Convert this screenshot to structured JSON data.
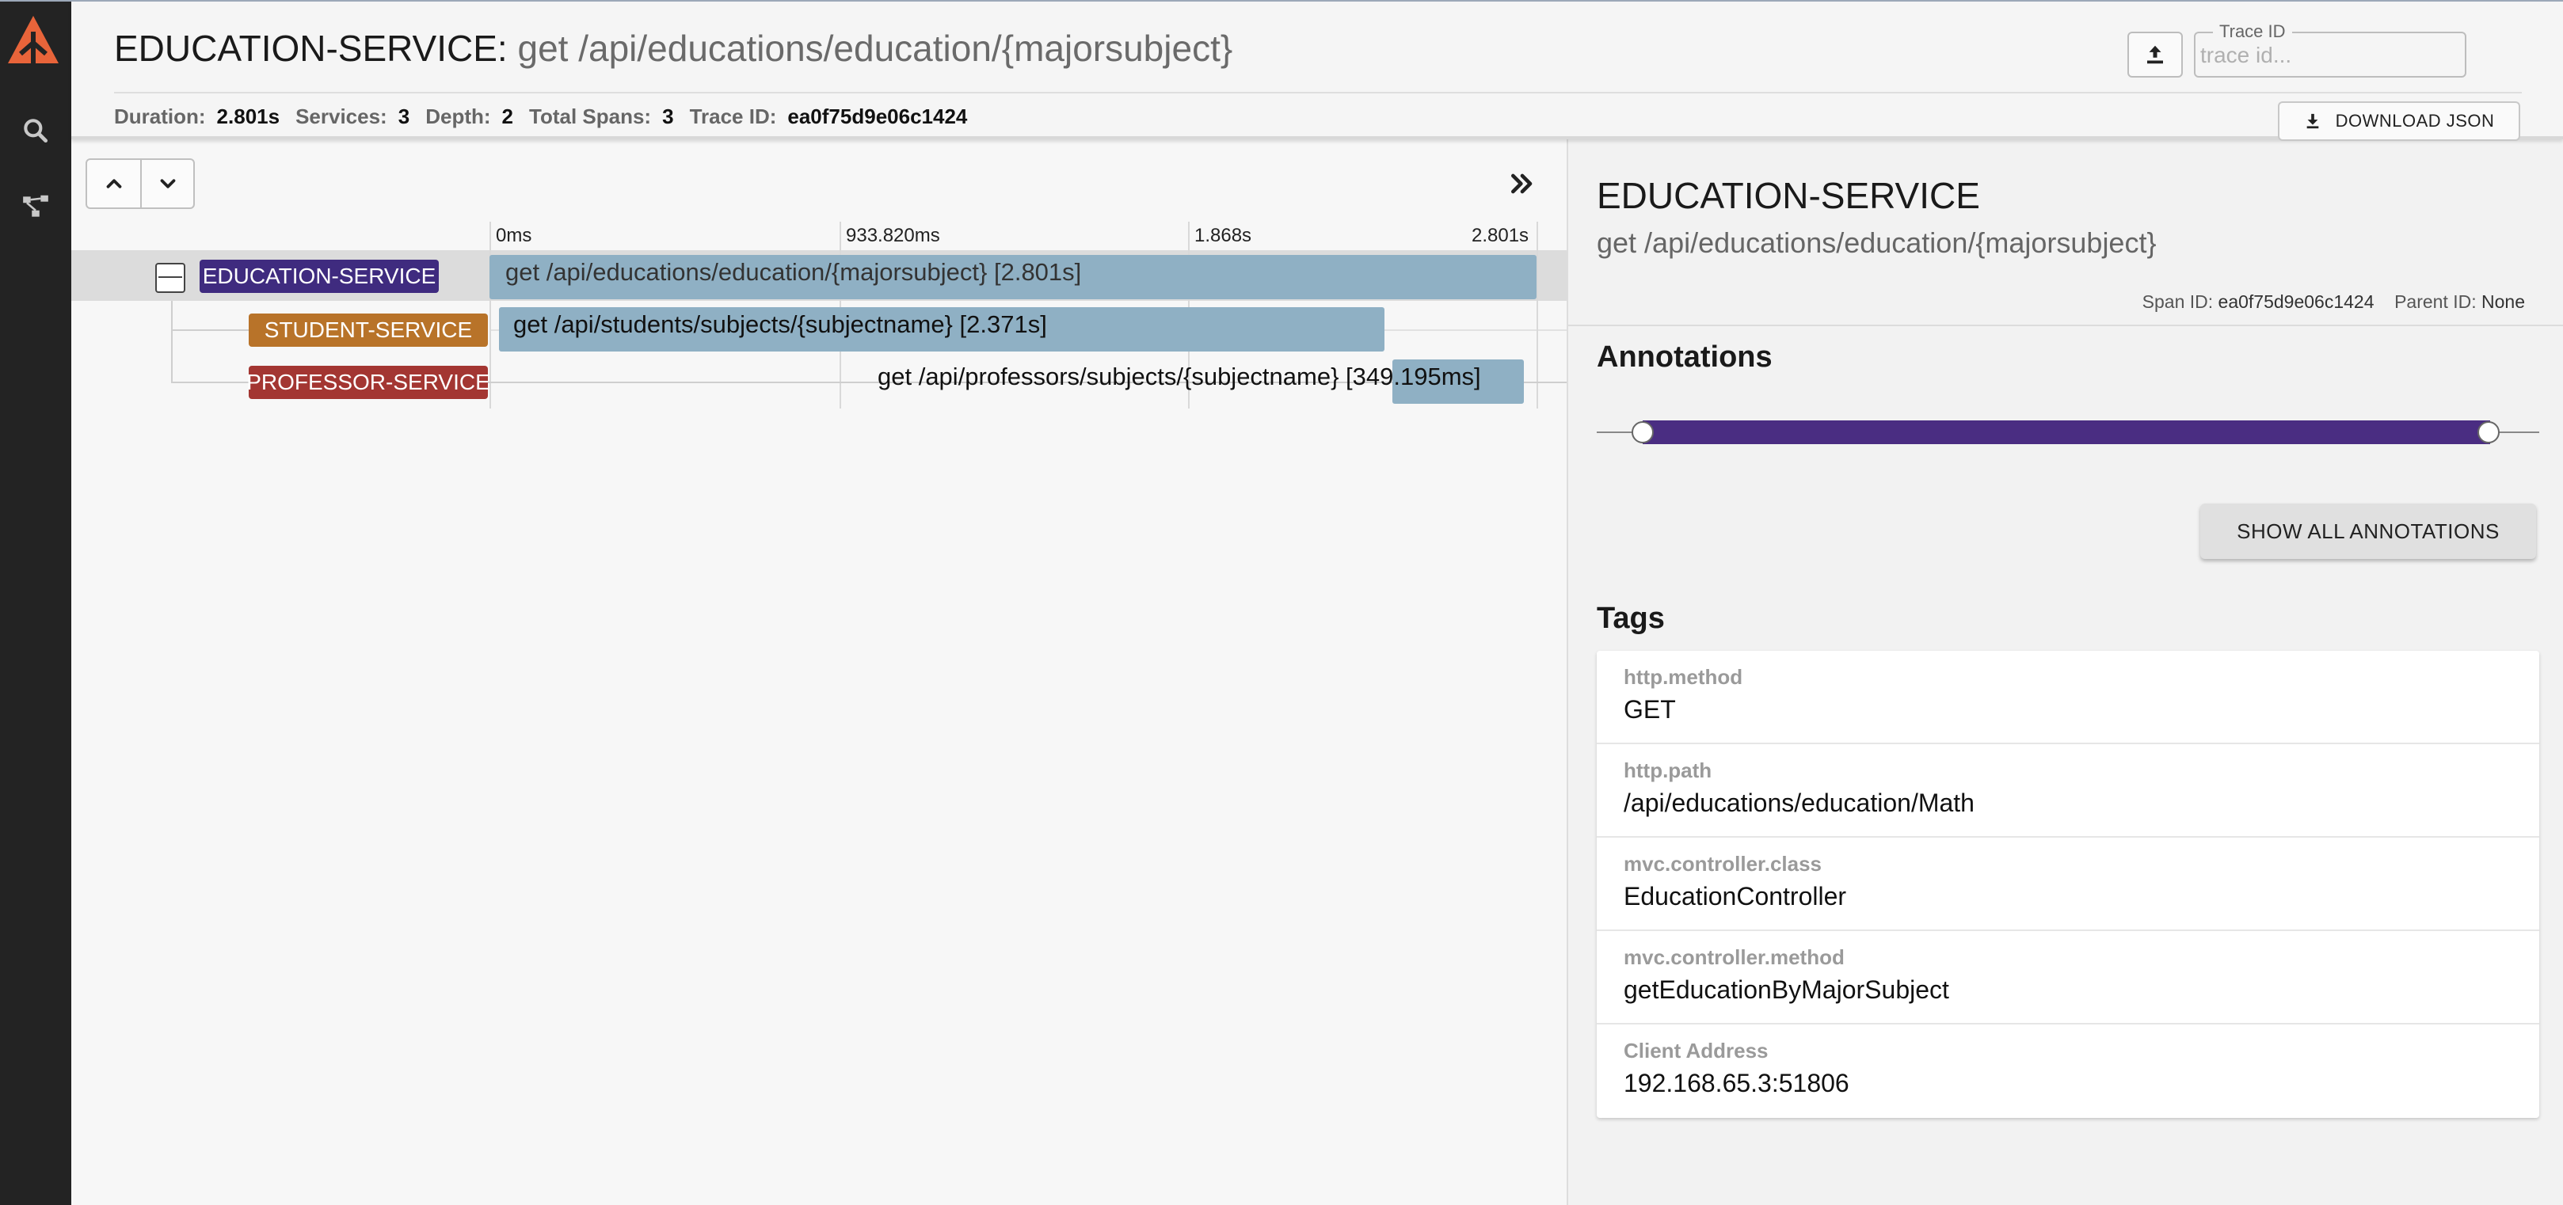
{
  "colors": {
    "sidebar_bg": "#232323",
    "logo_orange": "#e8643a",
    "education_service": "#3f2b7f",
    "student_service": "#b87329",
    "professor_service": "#a33632",
    "span_bar": "#8fb0c4",
    "annotation_bar": "#4a2d82"
  },
  "sidebar": {
    "icons": [
      "logo-icon",
      "search-icon",
      "dependency-graph-icon"
    ]
  },
  "header": {
    "service_name": "EDUCATION-SERVICE",
    "separator": ":",
    "operation": " get /api/educations/education/{majorsubject}",
    "stats": {
      "duration_label": "Duration:",
      "duration_value": "2.801s",
      "services_label": "Services:",
      "services_value": "3",
      "depth_label": "Depth:",
      "depth_value": "2",
      "total_spans_label": "Total Spans:",
      "total_spans_value": "3",
      "trace_id_label": "Trace ID:",
      "trace_id_value": "ea0f75d9e06c1424"
    },
    "trace_id_field": {
      "label": "Trace ID",
      "placeholder": "trace id..."
    },
    "download_label": "DOWNLOAD JSON"
  },
  "timeline": {
    "ticks": [
      "0ms",
      "933.820ms",
      "1.868s",
      "2.801s"
    ],
    "spans": [
      {
        "service": "EDUCATION-SERVICE",
        "label": "get /api/educations/education/{majorsubject} [2.801s]"
      },
      {
        "service": "STUDENT-SERVICE",
        "label": "get /api/students/subjects/{subjectname} [2.371s]"
      },
      {
        "service": "PROFESSOR-SERVICE",
        "label": "get /api/professors/subjects/{subjectname} [349.195ms]"
      }
    ]
  },
  "detail": {
    "service_name": "EDUCATION-SERVICE",
    "operation": "get /api/educations/education/{majorsubject}",
    "span_id_label": "Span ID:",
    "span_id_value": "ea0f75d9e06c1424",
    "parent_id_label": "Parent ID:",
    "parent_id_value": "None",
    "annotations_title": "Annotations",
    "show_all_label": "SHOW ALL ANNOTATIONS",
    "tags_title": "Tags",
    "tags": [
      {
        "key": "http.method",
        "value": "GET"
      },
      {
        "key": "http.path",
        "value": "/api/educations/education/Math"
      },
      {
        "key": "mvc.controller.class",
        "value": "EducationController"
      },
      {
        "key": "mvc.controller.method",
        "value": "getEducationByMajorSubject"
      },
      {
        "key": "Client Address",
        "value": "192.168.65.3:51806"
      }
    ]
  }
}
